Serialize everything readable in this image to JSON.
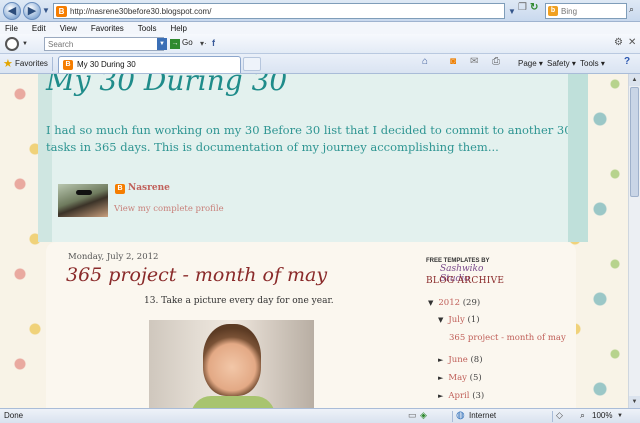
{
  "browser": {
    "address": "http://nasrene30before30.blogspot.com/",
    "search_placeholder": "Bing",
    "menu": [
      "File",
      "Edit",
      "View",
      "Favorites",
      "Tools",
      "Help"
    ],
    "toolbar_search_placeholder": "Search",
    "go_label": "Go",
    "favorites_label": "Favorites",
    "tab_title": "My 30 During 30",
    "commands": {
      "page": "Page ▾",
      "safety": "Safety ▾",
      "tools": "Tools ▾"
    },
    "status": {
      "text": "Done",
      "zone": "Internet",
      "zoom": "100%"
    }
  },
  "blog": {
    "title": "My 30 During 30",
    "description": "I had so much fun working on my 30 Before 30 list that I decided to commit to another 30 tasks in 365 days. This is documentation of my journey accomplishing them...",
    "profile": {
      "name": "Nasrene",
      "link": "View my complete profile"
    }
  },
  "post": {
    "date": "Monday, July 2, 2012",
    "title": "365 project - month of may",
    "body": "13. Take a picture every day for one year."
  },
  "sidebar": {
    "credit_line1": "FREE TEMPLATES BY",
    "credit_line2": "Sashwiko Studio",
    "archive_heading": "BLOG ARCHIVE",
    "archive": {
      "y2012": {
        "toggle": "▼",
        "label": "2012",
        "count": "(29)"
      },
      "july": {
        "toggle": "▼",
        "label": "July",
        "count": "(1)"
      },
      "post": "365 project - month of may",
      "june": {
        "toggle": "►",
        "label": "June",
        "count": "(8)"
      },
      "may": {
        "toggle": "►",
        "label": "May",
        "count": "(5)"
      },
      "april": {
        "toggle": "►",
        "label": "April",
        "count": "(3)"
      }
    }
  },
  "colors": {
    "title_teal": "#1f8c8a",
    "post_title": "#8a2a2a",
    "link": "#c0605a",
    "header_bg": "#e3f1ee"
  },
  "icons": [
    "back-icon",
    "forward-icon",
    "refresh-icon",
    "stop-icon",
    "search-icon",
    "star-icon",
    "home-icon",
    "feed-icon",
    "mail-icon",
    "print-icon",
    "help-icon",
    "globe-icon",
    "zoom-icon"
  ]
}
